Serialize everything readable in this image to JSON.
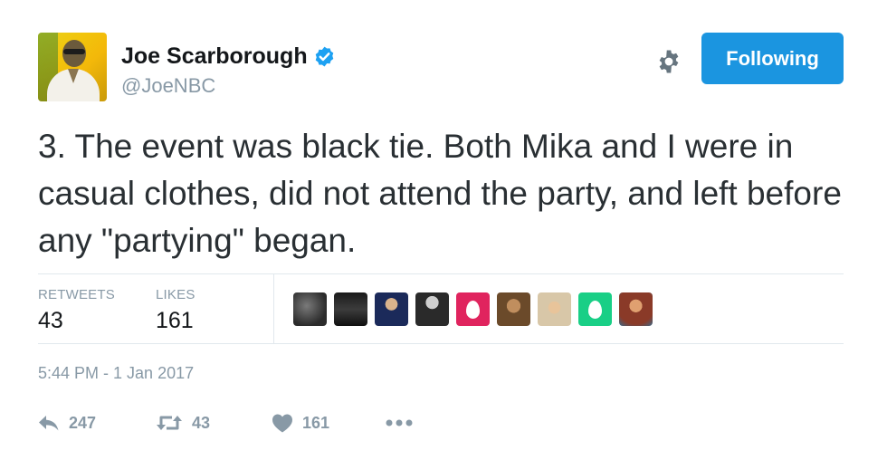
{
  "user": {
    "name": "Joe Scarborough",
    "handle": "@JoeNBC",
    "verified": true
  },
  "follow_button": {
    "label": "Following"
  },
  "tweet": {
    "text": "3. The event was black tie. Both Mika and I were in casual clothes, did not attend the party, and left before any \"partying\" began."
  },
  "stats": {
    "retweets_label": "RETWEETS",
    "retweets_value": "43",
    "likes_label": "LIKES",
    "likes_value": "161"
  },
  "likers": [
    {
      "icon": "liker-avatar-1"
    },
    {
      "icon": "liker-avatar-2"
    },
    {
      "icon": "liker-avatar-3"
    },
    {
      "icon": "liker-avatar-4"
    },
    {
      "icon": "default-egg-avatar",
      "color": "#e0245e"
    },
    {
      "icon": "liker-avatar-6"
    },
    {
      "icon": "liker-avatar-7"
    },
    {
      "icon": "default-egg-avatar",
      "color": "#19cf86"
    },
    {
      "icon": "liker-avatar-9"
    }
  ],
  "timestamp": "5:44 PM - 1 Jan 2017",
  "actions": {
    "reply_count": "247",
    "retweet_count": "43",
    "like_count": "161"
  },
  "colors": {
    "accent": "#1b95e0",
    "muted": "#8899a6",
    "text": "#292f33",
    "border": "#e1e8ed"
  }
}
